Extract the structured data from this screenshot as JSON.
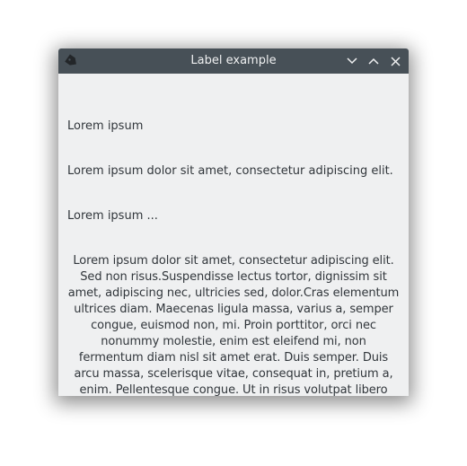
{
  "window": {
    "title": "Label example",
    "icon": "app-tag-icon",
    "controls": [
      "minimize-icon",
      "maximize-icon",
      "close-icon"
    ]
  },
  "labels": {
    "short": "Lorem ipsum",
    "sentence": "Lorem ipsum dolor sit amet, consectetur adipiscing elit.",
    "elided": "Lorem ipsum ...",
    "wrapped": "Lorem ipsum dolor sit amet, consectetur adipiscing elit. Sed non risus.Suspendisse lectus tortor, dignissim sit amet, adipiscing nec, ultricies sed, dolor.Cras elementum ultrices diam. Maecenas ligula massa, varius a, semper congue, euismod non, mi. Proin porttitor, orci nec nonummy molestie, enim est eleifend mi, non fermentum diam nisl sit amet erat. Duis semper. Duis arcu massa, scelerisque vitae, consequat in, pretium a, enim. Pellentesque congue. Ut in risus volutpat libero pharetra tempor."
  }
}
